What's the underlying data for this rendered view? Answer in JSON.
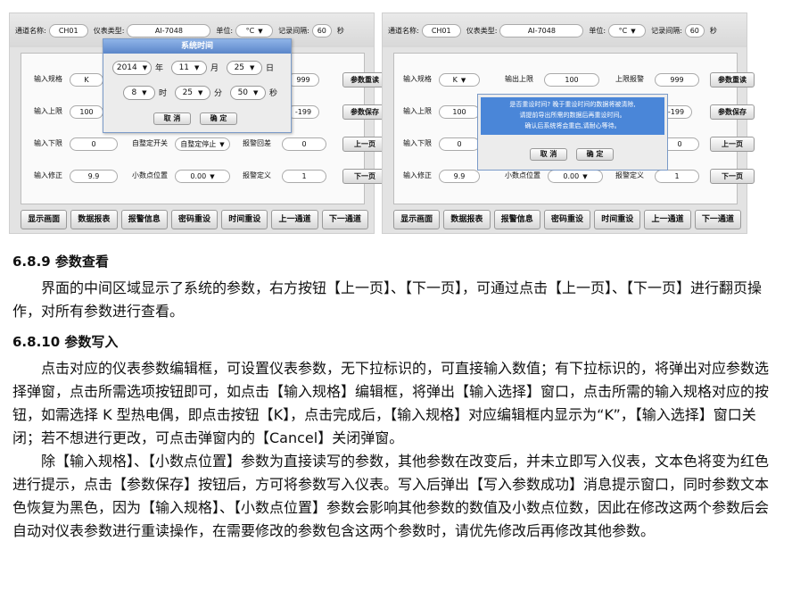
{
  "left_panel": {
    "top": {
      "channel_label": "通道名称:",
      "channel_value": "CH01",
      "type_label": "仪表类型:",
      "type_value": "AI-7048",
      "unit_label": "单位:",
      "unit_value": "°C",
      "interval_label": "记录间隔:",
      "interval_value": "60",
      "interval_unit": "秒"
    },
    "rows": [
      {
        "label": "输入规格",
        "value": "K",
        "mid_label": "",
        "mid_value": "",
        "right_value": "999",
        "button": "参数重读"
      },
      {
        "label": "输入上限",
        "value": "100",
        "mid_label": "",
        "mid_value": "",
        "right_value": "-199",
        "button": "参数保存"
      },
      {
        "label": "输入下限",
        "value": "0",
        "mid_label": "自整定开关",
        "mid_value": "自整定停止",
        "right_label": "报警回差",
        "right_value": "0",
        "button": "上一页"
      },
      {
        "label": "输入修正",
        "value": "9.9",
        "mid_label": "小数点位置",
        "mid_value": "0.00",
        "right_label": "报警定义",
        "right_value": "1",
        "button": "下一页"
      }
    ],
    "dialog": {
      "title": "系统时间",
      "year": "2014",
      "year_unit": "年",
      "month": "11",
      "month_unit": "月",
      "day": "25",
      "day_unit": "日",
      "hour": "8",
      "hour_unit": "时",
      "minute": "25",
      "minute_unit": "分",
      "second": "50",
      "second_unit": "秒",
      "cancel": "取 消",
      "ok": "确 定"
    }
  },
  "right_panel": {
    "top": {
      "channel_label": "通道名称:",
      "channel_value": "CH01",
      "type_label": "仪表类型:",
      "type_value": "AI-7048",
      "unit_label": "单位:",
      "unit_value": "°C",
      "interval_label": "记录间隔:",
      "interval_value": "60",
      "interval_unit": "秒"
    },
    "rows": [
      {
        "label": "输入规格",
        "value": "K",
        "mid_label": "输出上限",
        "mid_value": "100",
        "right_label": "上限报警",
        "right_value": "999",
        "button": "参数重读"
      },
      {
        "label": "输入上限",
        "value": "100",
        "mid_label": "",
        "mid_value": "",
        "right_value": "-199",
        "button": "参数保存"
      },
      {
        "label": "输入下限",
        "value": "0",
        "mid_label": "",
        "mid_value": "",
        "right_value": "0",
        "button": "上一页"
      },
      {
        "label": "输入修正",
        "value": "9.9",
        "mid_label": "小数点位置",
        "mid_value": "0.00",
        "right_label": "报警定义",
        "right_value": "1",
        "button": "下一页"
      }
    ],
    "confirm": {
      "line1": "是否重设时间? 晚于重设时间的数据将被清除,",
      "line2": "请提前导出所需的数据后再重设时间。",
      "line3": "确认后系统将会重启,请耐心等待。",
      "cancel": "取 消",
      "ok": "确 定"
    }
  },
  "bottom_buttons": [
    "显示画面",
    "数据报表",
    "报警信息",
    "密码重设",
    "时间重设",
    "上一通道",
    "下一通道"
  ],
  "doc": {
    "h1": "6.8.9 参数查看",
    "p1": "界面的中间区域显示了系统的参数，右方按钮【上一页】、【下一页】，可通过点击【上一页】、【下一页】进行翻页操作，对所有参数进行查看。",
    "h2": "6.8.10 参数写入",
    "p2": "点击对应的仪表参数编辑框，可设置仪表参数，无下拉标识的，可直接输入数值；有下拉标识的，将弹出对应参数选择弹窗，点击所需选项按钮即可，如点击【输入规格】编辑框，将弹出【输入选择】窗口，点击所需的输入规格对应的按钮，如需选择 K 型热电偶，即点击按钮【K】，点击完成后，【输入规格】对应编辑框内显示为“K”，【输入选择】窗口关闭；若不想进行更改，可点击弹窗内的【Cancel】关闭弹窗。",
    "p3": "除【输入规格】、【小数点位置】参数为直接读写的参数，其他参数在改变后，并未立即写入仪表，文本色将变为红色进行提示，点击【参数保存】按钮后，方可将参数写入仪表。写入后弹出【写入参数成功】消息提示窗口，同时参数文本色恢复为黑色，因为【输入规格】、【小数点位置】参数会影响其他参数的数值及小数点位数，因此在修改这两个参数后会自动对仪表参数进行重读操作，在需要修改的参数包含这两个参数时，请优先修改后再修改其他参数。"
  }
}
